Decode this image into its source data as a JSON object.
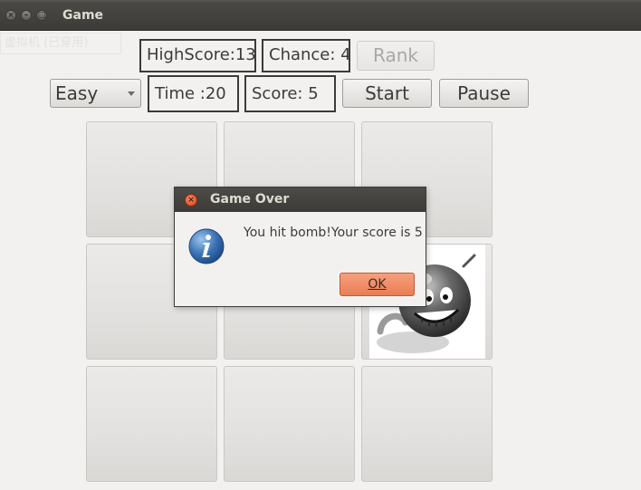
{
  "window": {
    "title": "Game"
  },
  "background_text": "虚拟机 (已穿用)",
  "stats": {
    "high_score": "HighScore:13",
    "chance": "Chance: 4",
    "time": "Time :20",
    "score": "Score: 5"
  },
  "buttons": {
    "rank": "Rank",
    "start": "Start",
    "pause": "Pause"
  },
  "difficulty": {
    "selected": "Easy"
  },
  "grid": {
    "rows": 3,
    "cols": 3,
    "revealed_tile": {
      "row": 2,
      "col": 3,
      "content": "bomb-face-image"
    }
  },
  "dialog": {
    "title": "Game Over",
    "message": "You hit bomb!Your score is 5",
    "ok_label": "OK",
    "icon": "info-icon"
  },
  "colors": {
    "titlebar": "#3c3b37",
    "ok_button": "#ea7d53",
    "close_button": "#d9461b",
    "info_icon": "#3d74b5"
  }
}
